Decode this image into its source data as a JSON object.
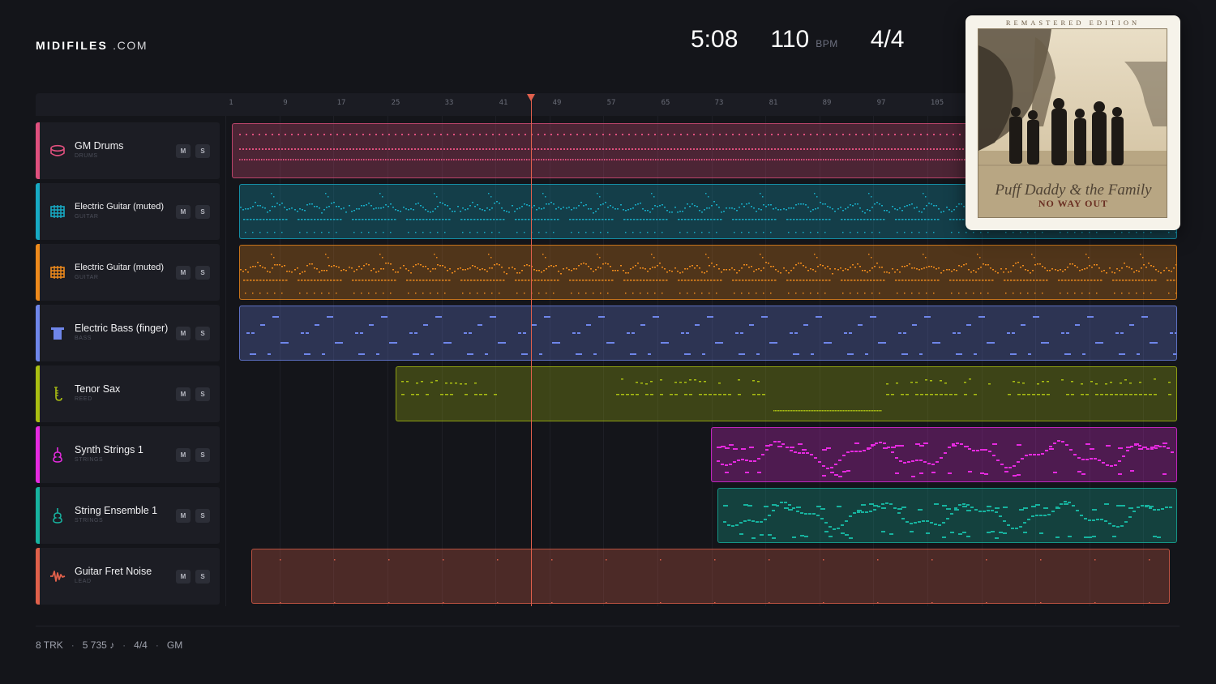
{
  "brand": {
    "name": "MIDIFILES",
    "suffix": ".COM"
  },
  "transport": {
    "time": "5:08",
    "tempo": "110",
    "tempo_unit": "BPM",
    "meter": "4/4"
  },
  "ruler": {
    "bars": [
      "1",
      "9",
      "17",
      "25",
      "33",
      "41",
      "49",
      "57",
      "65",
      "73",
      "81",
      "89",
      "97",
      "105"
    ]
  },
  "tracks": [
    {
      "name": "GM Drums",
      "type": "DRUMS",
      "color": "#e0507e",
      "icon": "drum-icon",
      "mute": "M",
      "solo": "S"
    },
    {
      "name": "Electric Guitar (muted)",
      "type": "GUITAR",
      "color": "#17aac4",
      "icon": "guitar-icon",
      "mute": "M",
      "solo": "S"
    },
    {
      "name": "Electric Guitar (muted)",
      "type": "GUITAR",
      "color": "#ee8a1c",
      "icon": "guitar-icon",
      "mute": "M",
      "solo": "S"
    },
    {
      "name": "Electric Bass (finger)",
      "type": "BASS",
      "color": "#6f86ea",
      "icon": "bass-icon",
      "mute": "M",
      "solo": "S"
    },
    {
      "name": "Tenor Sax",
      "type": "REED",
      "color": "#aabf12",
      "icon": "sax-icon",
      "mute": "M",
      "solo": "S"
    },
    {
      "name": "Synth Strings 1",
      "type": "STRINGS",
      "color": "#e62ae0",
      "icon": "violin-icon",
      "mute": "M",
      "solo": "S"
    },
    {
      "name": "String Ensemble 1",
      "type": "STRINGS",
      "color": "#17b39f",
      "icon": "violin-icon",
      "mute": "M",
      "solo": "S"
    },
    {
      "name": "Guitar Fret Noise",
      "type": "LEAD",
      "color": "#e0604a",
      "icon": "waveform-icon",
      "mute": "M",
      "solo": "S"
    }
  ],
  "album": {
    "edition": "REMASTERED EDITION",
    "artist": "Puff Daddy & the Family",
    "title": "NO WAY OUT"
  },
  "footer": {
    "tracks": "8 TRK",
    "notes": "5 735 ♪",
    "meter": "4/4",
    "standard": "GM"
  }
}
